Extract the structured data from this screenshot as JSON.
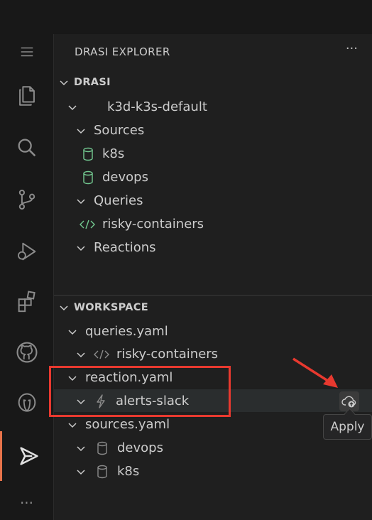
{
  "explorer": {
    "title": "DRASI EXPLORER",
    "more": "···"
  },
  "drasi": {
    "section_label": "DRASI",
    "cluster": "k3d-k3s-default",
    "sources_label": "Sources",
    "sources": [
      "k8s",
      "devops"
    ],
    "queries_label": "Queries",
    "queries": [
      "risky-containers"
    ],
    "reactions_label": "Reactions"
  },
  "workspace": {
    "section_label": "WORKSPACE",
    "files": [
      {
        "name": "queries.yaml",
        "child": "risky-containers"
      },
      {
        "name": "reaction.yaml",
        "child": "alerts-slack"
      },
      {
        "name": "sources.yaml",
        "children": [
          "devops",
          "k8s"
        ]
      }
    ]
  },
  "tooltip": {
    "label": "Apply"
  },
  "colors": {
    "accent": "#e8734a",
    "annotation": "#e8392f",
    "database": "#73c991",
    "code": "#73c991"
  }
}
